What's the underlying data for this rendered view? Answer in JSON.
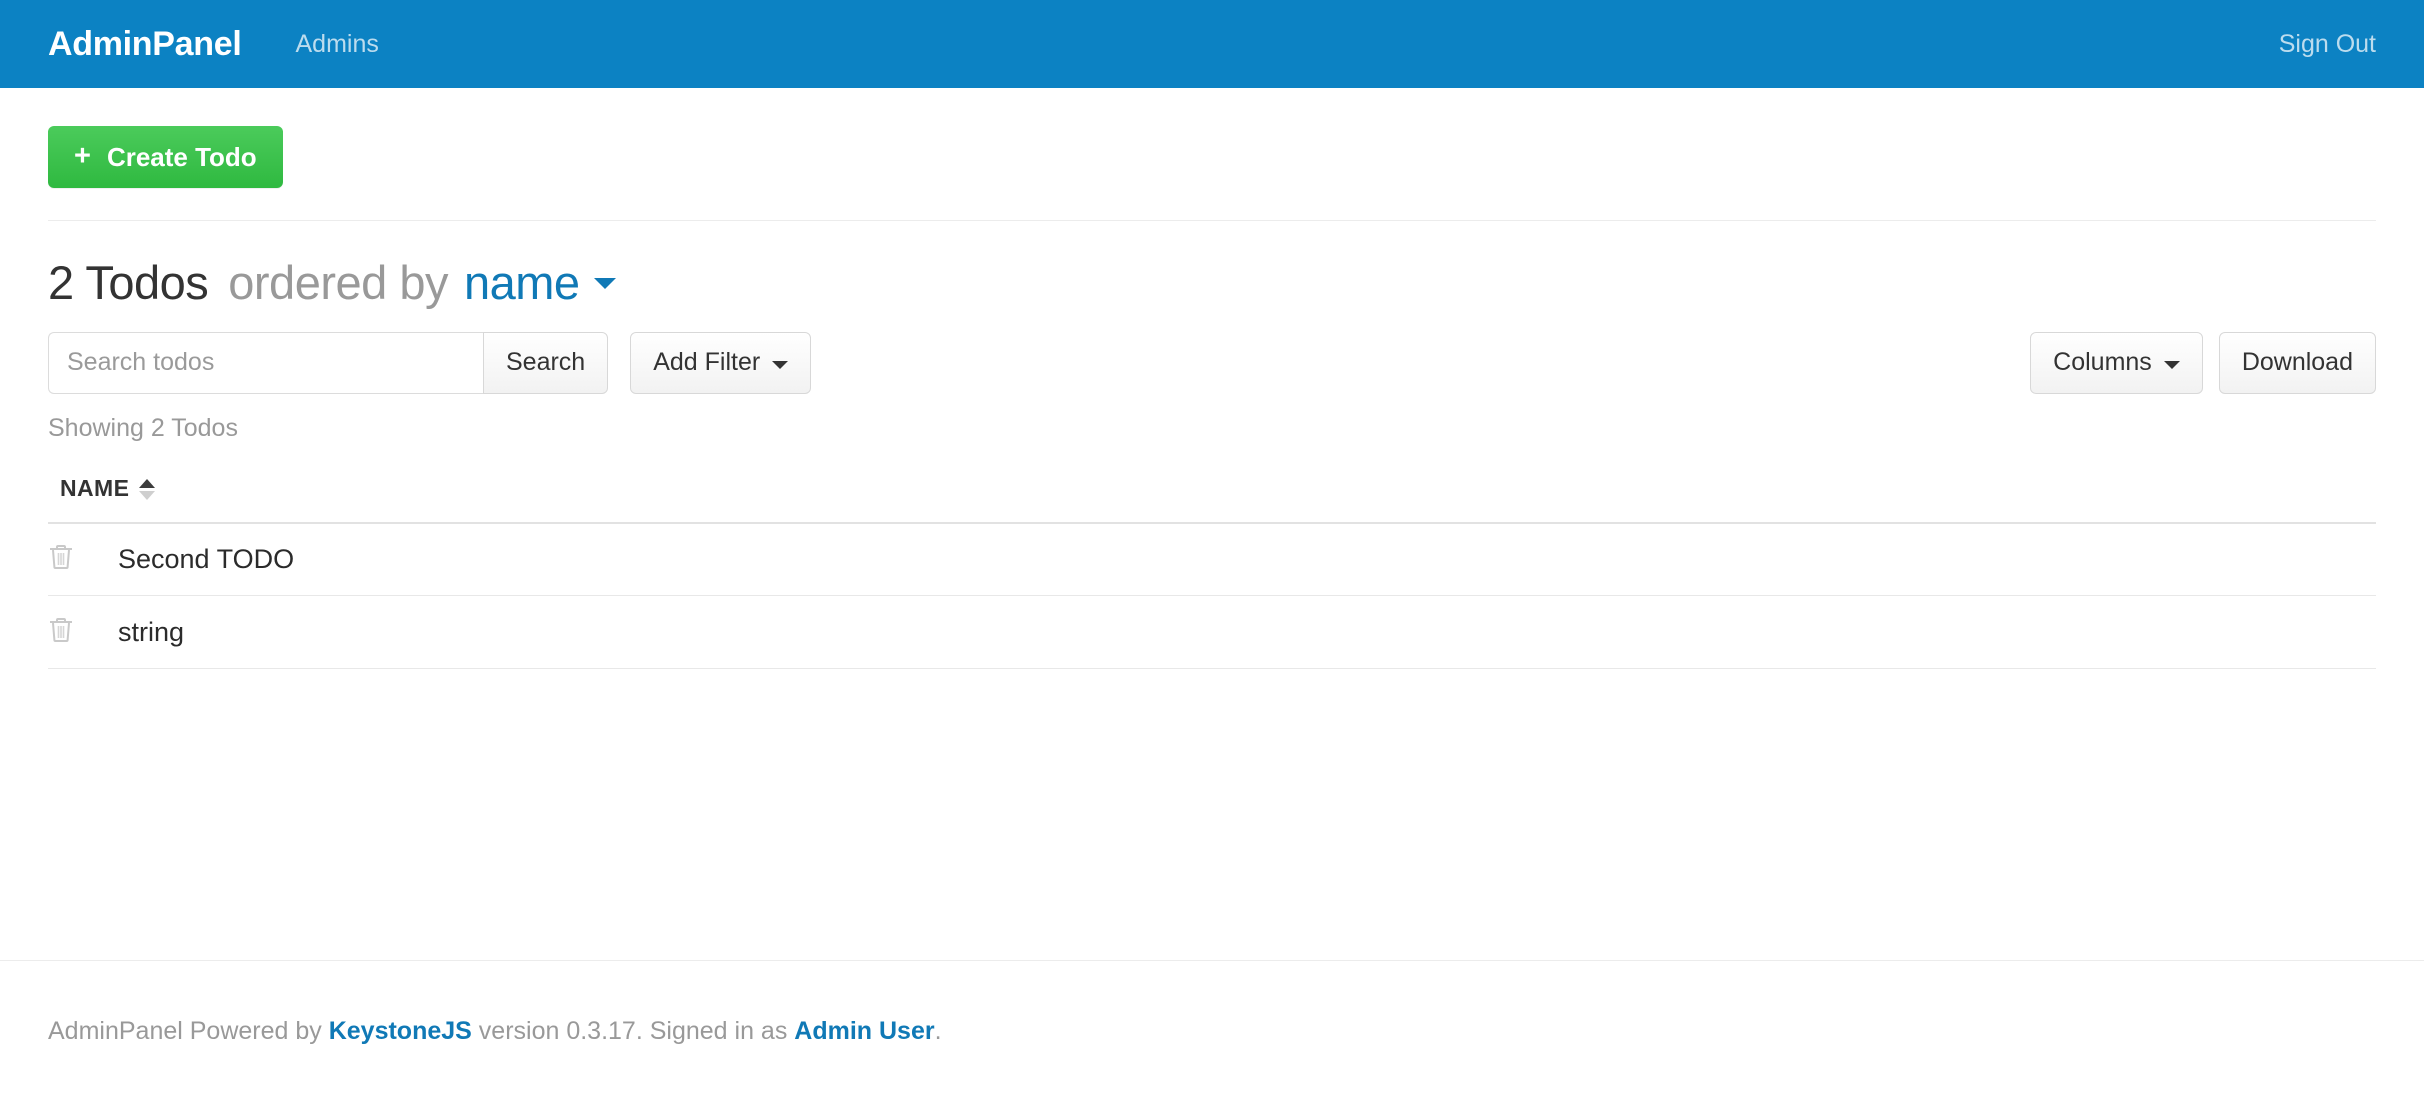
{
  "header": {
    "brand": "AdminPanel",
    "nav_items": [
      {
        "label": "Admins"
      }
    ],
    "sign_out": "Sign Out",
    "bg_color": "#0c82c3",
    "link_color": "#bcdcee"
  },
  "toolbar": {
    "create_label": "Create Todo",
    "create_plus": "+",
    "create_color": "#3ac04a"
  },
  "list": {
    "count_label": "2 Todos",
    "ordered_by_label": "ordered by",
    "sort_field": "name",
    "sort_field_color": "#1079b6",
    "showing_label": "Showing 2 Todos"
  },
  "search": {
    "placeholder": "Search todos",
    "value": "",
    "search_button": "Search",
    "add_filter_button": "Add Filter"
  },
  "actions": {
    "columns_button": "Columns",
    "download_button": "Download"
  },
  "table": {
    "columns": [
      {
        "label": "NAME",
        "sort_icon": "sort-updown-icon"
      }
    ],
    "rows": [
      {
        "delete_icon": "trash-icon",
        "name": "Second TODO"
      },
      {
        "delete_icon": "trash-icon",
        "name": "string"
      }
    ]
  },
  "footer": {
    "prefix": "AdminPanel Powered by ",
    "engine_link": "KeystoneJS",
    "version_text": " version 0.3.17. Signed in as ",
    "user_link": "Admin User",
    "suffix": "."
  }
}
